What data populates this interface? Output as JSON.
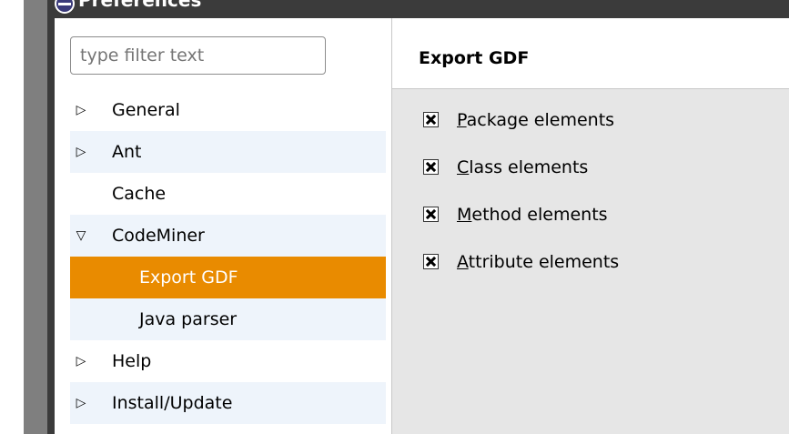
{
  "window": {
    "title": "Preferences",
    "icon": "eclipse-icon"
  },
  "filter": {
    "placeholder": "type filter text"
  },
  "tree": {
    "items": [
      {
        "label": "General",
        "expand_icon": "triangle-right-icon",
        "selected": false
      },
      {
        "label": "Ant",
        "expand_icon": "triangle-right-icon",
        "selected": false
      },
      {
        "label": "Cache",
        "expand_icon": "",
        "selected": false
      },
      {
        "label": "CodeMiner",
        "expand_icon": "triangle-down-icon",
        "selected": false
      },
      {
        "label": "Export GDF",
        "expand_icon": "",
        "selected": true
      },
      {
        "label": "Java parser",
        "expand_icon": "",
        "selected": false
      },
      {
        "label": "Help",
        "expand_icon": "triangle-right-icon",
        "selected": false
      },
      {
        "label": "Install/Update",
        "expand_icon": "triangle-right-icon",
        "selected": false
      }
    ]
  },
  "page": {
    "title": "Export GDF",
    "options": [
      {
        "mnemonic": "P",
        "rest": "ackage elements",
        "checked": true
      },
      {
        "mnemonic": "C",
        "rest": "lass elements",
        "checked": true
      },
      {
        "mnemonic": "M",
        "rest": "ethod elements",
        "checked": true
      },
      {
        "mnemonic": "A",
        "rest": "ttribute elements",
        "checked": true
      }
    ]
  },
  "colors": {
    "selection": "#e98b00",
    "alt_row": "#eef4fb",
    "title_bar": "#3b3b3b",
    "page_background": "#e6e6e6"
  }
}
